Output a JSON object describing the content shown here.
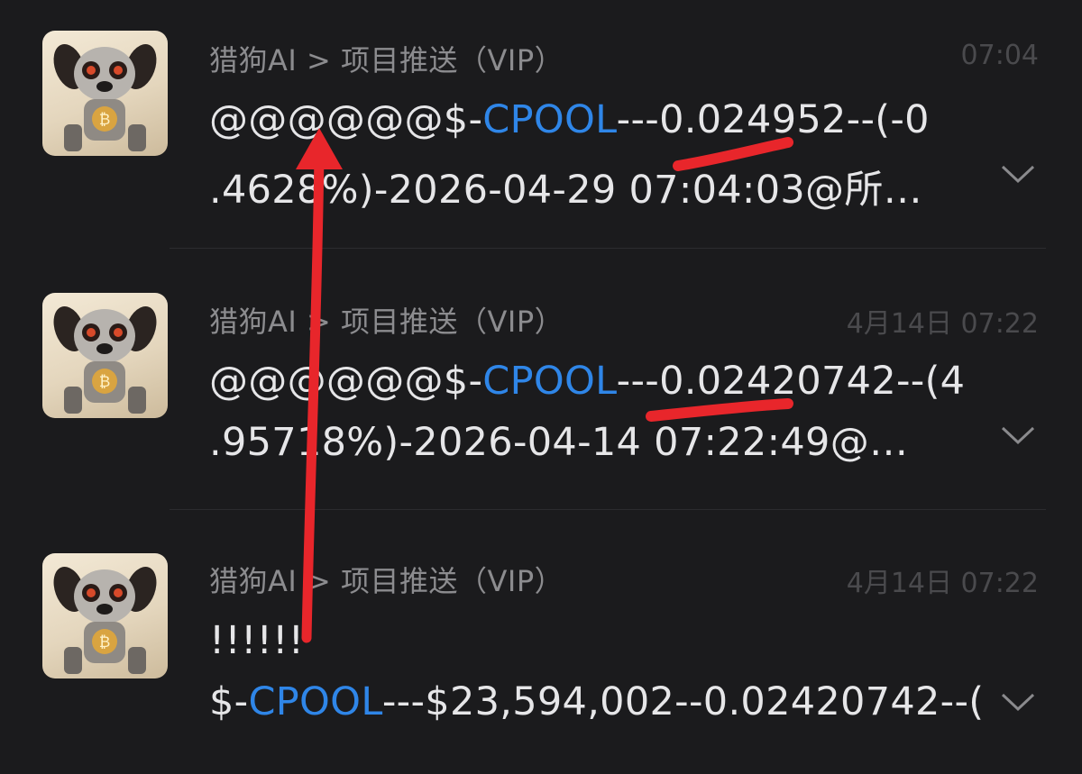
{
  "messages": [
    {
      "sender": "猎狗AI > 项目推送（VIP）",
      "time": "07:04",
      "line1_prefix": "@@@@@@$-",
      "line1_ticker": "CPOOL",
      "line1_rest": "---0.024952--(-0",
      "line2": ".4628%)-2026-04-29 07:04:03@所…"
    },
    {
      "sender": "猎狗AI > 项目推送（VIP）",
      "time": "4月14日 07:22",
      "line1_prefix": "@@@@@@$-",
      "line1_ticker": "CPOOL",
      "line1_rest": "---0.02420742--(4",
      "line2": ".95718%)-2026-04-14 07:22:49@…"
    },
    {
      "sender": "猎狗AI > 项目推送（VIP）",
      "time": "4月14日 07:22",
      "line1": "!!!!!!",
      "line2_prefix": "$-",
      "line2_ticker": "CPOOL",
      "line2_rest": "---$23,594,002--0.02420742--("
    }
  ],
  "colors": {
    "background": "#1b1b1d",
    "ticker": "#2f86e8",
    "annotation": "#e8262b"
  },
  "icons": {
    "avatar": "robot-dog-avatar-icon",
    "expand": "chevron-down-icon"
  }
}
